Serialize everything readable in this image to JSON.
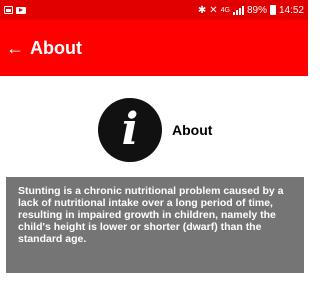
{
  "status_bar": {
    "icons": [
      "gallery-icon",
      "video-icon",
      "bluetooth-icon",
      "mute-icon",
      "signal-icon"
    ],
    "network": "4G",
    "battery": "89%",
    "time": "14:52"
  },
  "app_bar": {
    "back_icon": "arrow-left-icon",
    "back_glyph": "←",
    "title": "About"
  },
  "about": {
    "icon": "info-icon",
    "icon_glyph": "i",
    "label": "About",
    "description": "Stunting is a chronic nutritional problem caused by a lack of nutritional intake over a long period of time, resulting in impaired growth in children, namely the child's height is lower or shorter (dwarf) than the standard age."
  },
  "colors": {
    "status_bar": "#e00000",
    "app_bar": "#ff0000",
    "card": "#757575",
    "text_on_color": "#ffffff"
  }
}
